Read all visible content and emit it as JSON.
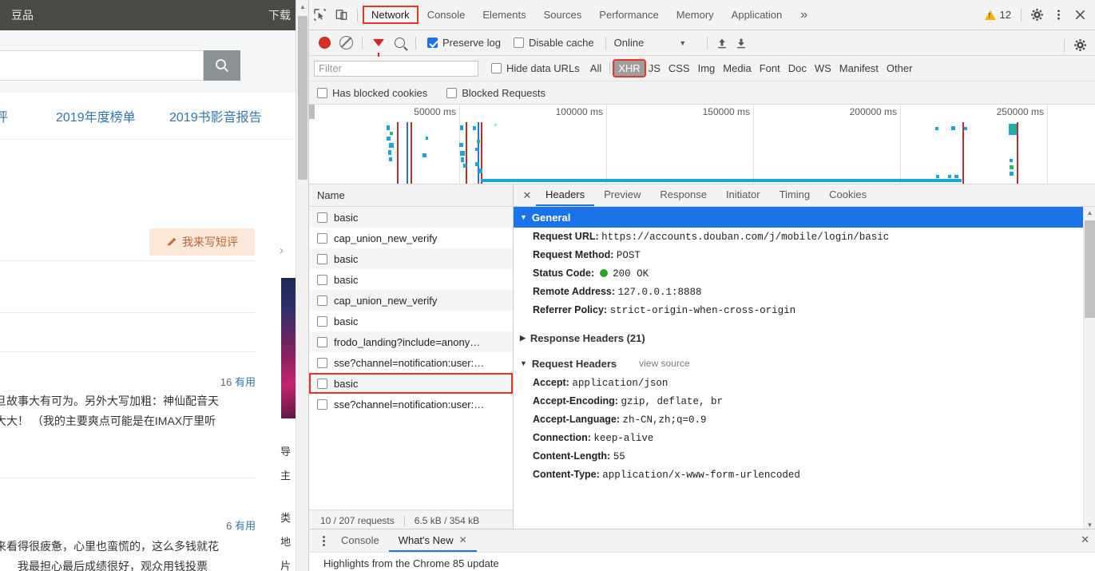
{
  "page": {
    "topbar": {
      "brand": "豆品",
      "download": "下载"
    },
    "search": {
      "value": "",
      "placeholder": "",
      "button_icon": "search-icon"
    },
    "nav": [
      "影评",
      "2019年度榜单",
      "2019书影音报告"
    ],
    "write_review_button": {
      "label": "我来写短评",
      "icon": "pencil-icon"
    },
    "reviews": [
      {
        "useful_count": "16",
        "useful_label": "有用",
        "line1": "旦故事大有可为。另外大写加粗：神仙配音天",
        "line2": "大大！ （我的主要爽点可能是在IMAX厅里听"
      },
      {
        "useful_count": "6",
        "useful_label": "有用",
        "line1": "来看得很疲惫，心里也蛮慌的，这么多钱就花",
        "line2": "我最担心最后成绩很好，观众用钱投票"
      }
    ],
    "chevron": "›",
    "sidebar_labels": [
      "导",
      "主",
      "类",
      "地",
      "片"
    ]
  },
  "devtools": {
    "tabs": [
      {
        "label": "Network",
        "active": true,
        "highlighted": true
      },
      {
        "label": "Console",
        "active": false,
        "highlighted": false
      },
      {
        "label": "Elements",
        "active": false,
        "highlighted": false
      },
      {
        "label": "Sources",
        "active": false,
        "highlighted": false
      },
      {
        "label": "Performance",
        "active": false,
        "highlighted": false
      },
      {
        "label": "Memory",
        "active": false,
        "highlighted": false
      },
      {
        "label": "Application",
        "active": false,
        "highlighted": false
      }
    ],
    "more_tabs_icon": "»",
    "warnings": {
      "count": "12",
      "icon": "warning-triangle-icon"
    },
    "window_icons": [
      "inspect-icon",
      "device-toolbar-icon",
      "settings-gear-icon",
      "more-vertical-icon",
      "close-icon"
    ],
    "toolbar": {
      "record_icon": "record-icon",
      "clear_icon": "clear-icon",
      "filter_icon": "filter-icon",
      "search_icon": "search-icon",
      "preserve_log": {
        "label": "Preserve log",
        "checked": true
      },
      "disable_cache": {
        "label": "Disable cache",
        "checked": false
      },
      "throttling": {
        "value": "Online"
      },
      "upload_icon": "upload-icon",
      "download_icon": "download-icon",
      "settings_icon": "gear-icon"
    },
    "filterbar": {
      "filter_placeholder": "Filter",
      "filter_value": "",
      "hide_data_urls": {
        "label": "Hide data URLs",
        "checked": false
      },
      "types": [
        {
          "label": "All",
          "active": false,
          "highlighted": false
        },
        {
          "label": "XHR",
          "active": true,
          "highlighted": true
        },
        {
          "label": "JS",
          "active": false,
          "highlighted": false
        },
        {
          "label": "CSS",
          "active": false,
          "highlighted": false
        },
        {
          "label": "Img",
          "active": false,
          "highlighted": false
        },
        {
          "label": "Media",
          "active": false,
          "highlighted": false
        },
        {
          "label": "Font",
          "active": false,
          "highlighted": false
        },
        {
          "label": "Doc",
          "active": false,
          "highlighted": false
        },
        {
          "label": "WS",
          "active": false,
          "highlighted": false
        },
        {
          "label": "Manifest",
          "active": false,
          "highlighted": false
        },
        {
          "label": "Other",
          "active": false,
          "highlighted": false
        }
      ],
      "has_blocked_cookies": {
        "label": "Has blocked cookies",
        "checked": false
      },
      "blocked_requests": {
        "label": "Blocked Requests",
        "checked": false
      }
    },
    "overview": {
      "ticks": [
        "50000 ms",
        "100000 ms",
        "150000 ms",
        "200000 ms",
        "250000 ms"
      ]
    },
    "requests": {
      "column_header": "Name",
      "rows": [
        {
          "name": "basic",
          "checked": false,
          "highlighted": false
        },
        {
          "name": "cap_union_new_verify",
          "checked": false,
          "highlighted": false
        },
        {
          "name": "basic",
          "checked": false,
          "highlighted": false
        },
        {
          "name": "basic",
          "checked": false,
          "highlighted": false
        },
        {
          "name": "cap_union_new_verify",
          "checked": false,
          "highlighted": false
        },
        {
          "name": "basic",
          "checked": false,
          "highlighted": false
        },
        {
          "name": "frodo_landing?include=anony…",
          "checked": false,
          "highlighted": false
        },
        {
          "name": "sse?channel=notification:user:…",
          "checked": false,
          "highlighted": false
        },
        {
          "name": "basic",
          "checked": false,
          "highlighted": true
        },
        {
          "name": "sse?channel=notification:user:…",
          "checked": false,
          "highlighted": false
        }
      ],
      "footer": {
        "requests": "10 / 207 requests",
        "transferred": "6.5 kB / 354 kB"
      }
    },
    "detail": {
      "close_icon": "close-icon",
      "tabs": [
        {
          "label": "Headers",
          "active": true
        },
        {
          "label": "Preview",
          "active": false
        },
        {
          "label": "Response",
          "active": false
        },
        {
          "label": "Initiator",
          "active": false
        },
        {
          "label": "Timing",
          "active": false
        },
        {
          "label": "Cookies",
          "active": false
        }
      ],
      "general": {
        "title": "General",
        "expanded": true,
        "items": [
          {
            "key": "Request URL:",
            "value": "https://accounts.douban.com/j/mobile/login/basic"
          },
          {
            "key": "Request Method:",
            "value": "POST"
          },
          {
            "key": "Status Code:",
            "value": "200 OK",
            "status_dot": "#2aa32a"
          },
          {
            "key": "Remote Address:",
            "value": "127.0.0.1:8888"
          },
          {
            "key": "Referrer Policy:",
            "value": "strict-origin-when-cross-origin"
          }
        ]
      },
      "response_headers": {
        "title": "Response Headers (21)",
        "expanded": false
      },
      "request_headers": {
        "title": "Request Headers",
        "view_source": "view source",
        "expanded": true,
        "items": [
          {
            "key": "Accept:",
            "value": "application/json"
          },
          {
            "key": "Accept-Encoding:",
            "value": "gzip, deflate, br"
          },
          {
            "key": "Accept-Language:",
            "value": "zh-CN,zh;q=0.9"
          },
          {
            "key": "Connection:",
            "value": "keep-alive"
          },
          {
            "key": "Content-Length:",
            "value": "55"
          },
          {
            "key": "Content-Type:",
            "value": "application/x-www-form-urlencoded"
          }
        ]
      }
    },
    "drawer": {
      "menu_icon": "more-vertical-icon",
      "tabs": [
        {
          "label": "Console",
          "active": false,
          "closable": false
        },
        {
          "label": "What's New",
          "active": true,
          "closable": true
        }
      ],
      "content": "Highlights from the Chrome 85 update",
      "close_icon": "close-icon"
    }
  }
}
